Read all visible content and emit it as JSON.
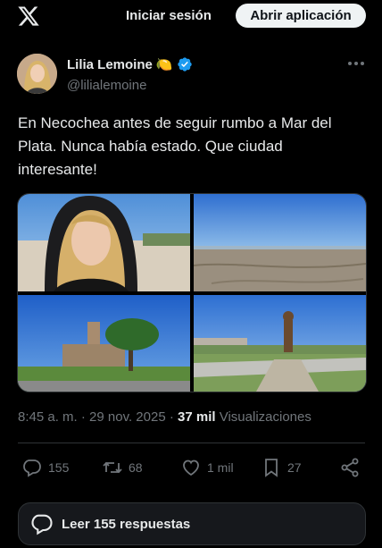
{
  "topbar": {
    "login_label": "Iniciar sesión",
    "open_app_label": "Abrir aplicación"
  },
  "post": {
    "author_name": "Lilia Lemoine",
    "author_emoji": "🍋",
    "handle": "@lilialemoine",
    "text": "En Necochea antes de seguir rumbo a Mar del Plata. Nunca había estado. Que ciudad interesante!",
    "time": "8:45 a. m.",
    "separator": "·",
    "date": "29 nov. 2025",
    "views_count": "37 mil",
    "views_label": "Visualizaciones"
  },
  "actions": {
    "replies": "155",
    "reposts": "68",
    "likes": "1 mil",
    "bookmarks": "27"
  },
  "read_replies_label": "Leer 155 respuestas",
  "icons": {
    "logo": "x-logo-icon",
    "verified": "verified-badge-icon",
    "more": "more-dots-icon",
    "reply": "reply-icon",
    "repost": "repost-icon",
    "like": "heart-icon",
    "bookmark": "bookmark-icon",
    "share": "share-icon"
  },
  "colors": {
    "background": "#000000",
    "verified": "#1d9bf0",
    "muted": "#71767b",
    "button_bg": "#eff3f4"
  }
}
